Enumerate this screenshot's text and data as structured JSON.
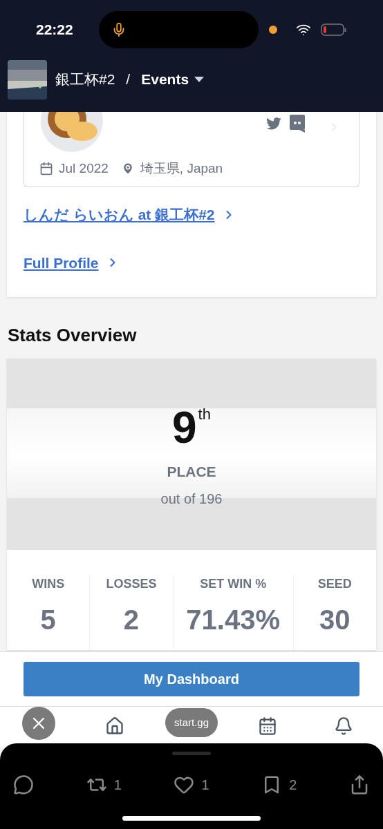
{
  "status_bar": {
    "time": "22:22"
  },
  "header": {
    "event": "銀工杯#2",
    "separator": "/",
    "section": "Events"
  },
  "profile": {
    "joined": "Jul 2022",
    "location": "埼玉県, Japan"
  },
  "links": [
    {
      "text": "しんだ らいおん **at** 銀工杯#2"
    },
    {
      "text": "Full Profile"
    }
  ],
  "stats": {
    "title": "Stats Overview",
    "place": "9",
    "suffix": "th",
    "place_label": "PLACE",
    "out_of": "out of 196",
    "items": [
      {
        "label": "WINS",
        "value": "5"
      },
      {
        "label": "LOSSES",
        "value": "2"
      },
      {
        "label": "SET WIN %",
        "value": "71.43%"
      },
      {
        "label": "SEED",
        "value": "30"
      }
    ]
  },
  "dashboard_button": "My Dashboard",
  "url_pill": "start.gg",
  "share_counts": [
    "1",
    "1",
    "2"
  ]
}
